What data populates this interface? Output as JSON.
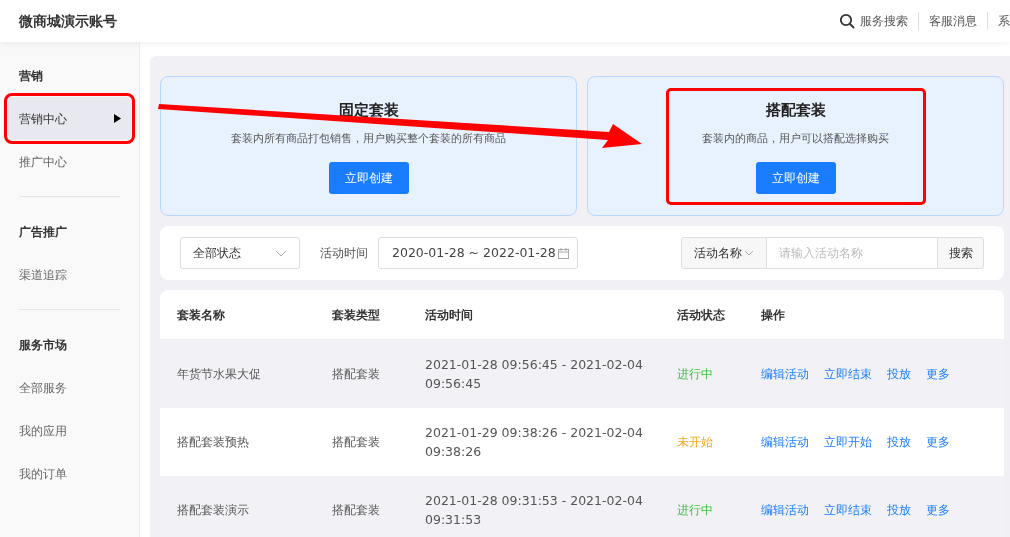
{
  "header": {
    "title": "微商城演示账号",
    "actions": [
      {
        "label": "服务搜索",
        "kind": "search"
      },
      {
        "label": "客服消息"
      },
      {
        "label": "系"
      }
    ]
  },
  "sidebar": {
    "sections": [
      {
        "title": "营销",
        "items": [
          {
            "label": "营销中心",
            "selected": true,
            "highlighted": true
          },
          {
            "label": "推广中心",
            "selected": false,
            "highlighted": false
          }
        ]
      },
      {
        "title": "广告推广",
        "items": [
          {
            "label": "渠道追踪",
            "selected": false,
            "highlighted": false
          }
        ]
      },
      {
        "title": "服务市场",
        "items": [
          {
            "label": "全部服务",
            "selected": false,
            "highlighted": false
          },
          {
            "label": "我的应用",
            "selected": false,
            "highlighted": false
          },
          {
            "label": "我的订单",
            "selected": false,
            "highlighted": false
          }
        ]
      }
    ]
  },
  "cards": [
    {
      "title": "固定套装",
      "description": "套装内所有商品打包销售，用户购买整个套装的所有商品",
      "button": "立即创建",
      "highlighted": false
    },
    {
      "title": "搭配套装",
      "description": "套装内的商品，用户可以搭配选择购买",
      "button": "立即创建",
      "highlighted": true
    }
  ],
  "filters": {
    "status_select": "全部状态",
    "date_label": "活动时间",
    "date_range": "2020-01-28 ~ 2022-01-28",
    "search_type": "活动名称",
    "search_placeholder": "请输入活动名称",
    "search_button": "搜索"
  },
  "table": {
    "columns": [
      "套装名称",
      "套装类型",
      "活动时间",
      "活动状态",
      "操作"
    ],
    "rows": [
      {
        "name": "年货节水果大促",
        "type": "搭配套装",
        "time": "2021-01-28 09:56:45 - 2021-02-04 09:56:45",
        "status": "进行中",
        "kind": "running",
        "actions": [
          "编辑活动",
          "立即结束",
          "投放",
          "更多"
        ]
      },
      {
        "name": "搭配套装预热",
        "type": "搭配套装",
        "time": "2021-01-29 09:38:26 - 2021-02-04 09:38:26",
        "status": "未开始",
        "kind": "pending",
        "actions": [
          "编辑活动",
          "立即开始",
          "投放",
          "更多"
        ]
      },
      {
        "name": "搭配套装演示",
        "type": "搭配套装",
        "time": "2021-01-28 09:31:53 - 2021-02-04 09:31:53",
        "status": "进行中",
        "kind": "running",
        "actions": [
          "编辑活动",
          "立即结束",
          "投放",
          "更多"
        ]
      }
    ]
  }
}
